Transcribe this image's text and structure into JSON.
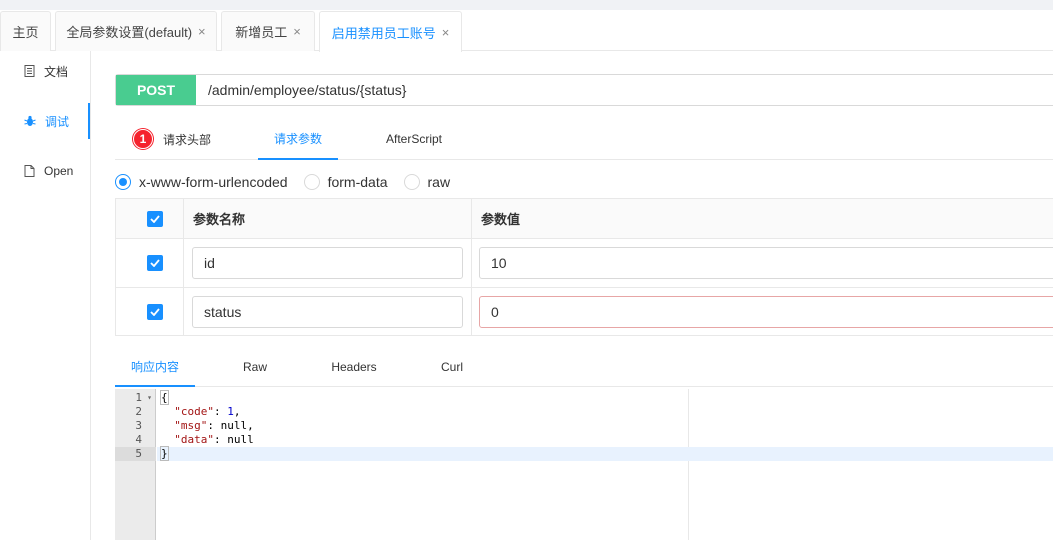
{
  "tabs": [
    {
      "label": "主页",
      "closable": false
    },
    {
      "label": "全局参数设置(default)",
      "closable": true
    },
    {
      "label": "新增员工",
      "closable": true
    },
    {
      "label": "启用禁用员工账号",
      "closable": true,
      "active": true
    }
  ],
  "close_glyph": "×",
  "sidebar": {
    "items": [
      {
        "label": "文档",
        "icon": "doc-icon"
      },
      {
        "label": "调试",
        "icon": "bug-icon",
        "active": true
      },
      {
        "label": "Open",
        "icon": "file-icon"
      }
    ]
  },
  "request": {
    "method": "POST",
    "url": "/admin/employee/status/{status}",
    "method_color": "#49cc90"
  },
  "subtabs": {
    "headers_badge": "1",
    "headers": "请求头部",
    "params": "请求参数",
    "afterscript": "AfterScript"
  },
  "body_types": [
    {
      "label": "x-www-form-urlencoded",
      "selected": true
    },
    {
      "label": "form-data",
      "selected": false
    },
    {
      "label": "raw",
      "selected": false
    }
  ],
  "params_table": {
    "headers": [
      "参数名称",
      "参数值"
    ],
    "rows": [
      {
        "checked": true,
        "name": "id",
        "value": "10"
      },
      {
        "checked": true,
        "name": "status",
        "value": "0"
      }
    ]
  },
  "response_tabs": [
    "响应内容",
    "Raw",
    "Headers",
    "Curl"
  ],
  "response": {
    "line_numbers": [
      "1",
      "2",
      "3",
      "4",
      "5"
    ],
    "open_brace": "{",
    "close_brace": "}",
    "fields": [
      {
        "key": "\"code\"",
        "value": "1",
        "trail": ","
      },
      {
        "key": "\"msg\"",
        "value": "null",
        "trail": ","
      },
      {
        "key": "\"data\"",
        "value": "null",
        "trail": ""
      }
    ]
  },
  "colors": {
    "accent": "#1890ff",
    "badge": "#f5222d",
    "post": "#49cc90"
  }
}
